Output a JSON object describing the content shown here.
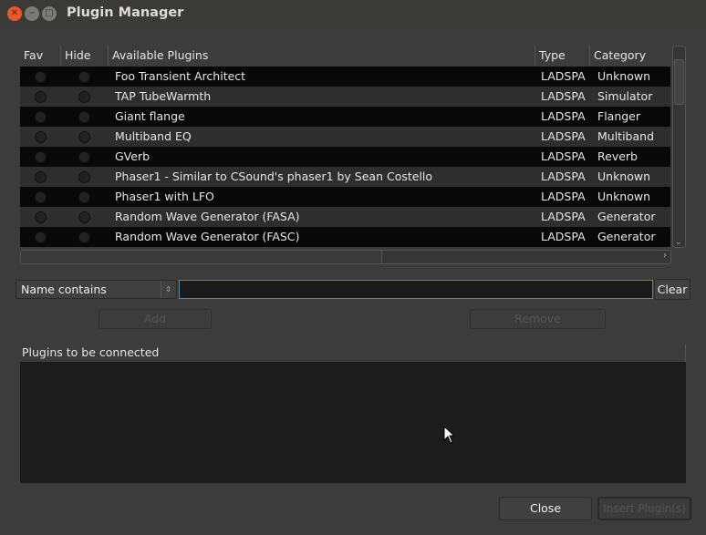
{
  "window": {
    "title": "Plugin Manager"
  },
  "table": {
    "headers": {
      "fav": "Fav",
      "hide": "Hide",
      "name": "Available Plugins",
      "type": "Type",
      "category": "Category"
    },
    "rows": [
      {
        "name": "Foo Transient Architect",
        "type": "LADSPA",
        "category": "Unknown"
      },
      {
        "name": "TAP TubeWarmth",
        "type": "LADSPA",
        "category": "Simulator"
      },
      {
        "name": "Giant flange",
        "type": "LADSPA",
        "category": "Flanger"
      },
      {
        "name": "Multiband EQ",
        "type": "LADSPA",
        "category": "Multiband"
      },
      {
        "name": "GVerb",
        "type": "LADSPA",
        "category": "Reverb"
      },
      {
        "name": "Phaser1 - Similar to CSound's phaser1 by Sean Costello",
        "type": "LADSPA",
        "category": "Unknown"
      },
      {
        "name": "Phaser1 with LFO",
        "type": "LADSPA",
        "category": "Unknown"
      },
      {
        "name": "Random Wave Generator (FASA)",
        "type": "LADSPA",
        "category": "Generator"
      },
      {
        "name": "Random Wave Generator (FASC)",
        "type": "LADSPA",
        "category": "Generator"
      }
    ]
  },
  "filter": {
    "mode": "Name contains",
    "value": "",
    "clear_label": "Clear"
  },
  "actions": {
    "add": "Add",
    "remove": "Remove"
  },
  "connected": {
    "header": "Plugins to be connected"
  },
  "footer": {
    "close": "Close",
    "insert": "Insert Plugin(s)"
  }
}
